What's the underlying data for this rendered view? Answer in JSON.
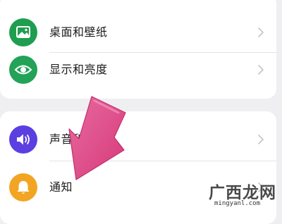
{
  "colors": {
    "wallpaper_icon": "#1f9e4f",
    "display_icon": "#23a258",
    "sound_icon": "#5b3fe0",
    "notification_icon": "#f2a522",
    "arrow": "#e04a86",
    "chevron": "#c4c4c8"
  },
  "settings": {
    "group1": [
      {
        "label": "桌面和壁纸",
        "icon": "picture-icon"
      },
      {
        "label": "显示和亮度",
        "icon": "eye-icon"
      }
    ],
    "group2": [
      {
        "label": "声音和振动",
        "icon": "speaker-icon"
      },
      {
        "label": "通知",
        "icon": "bell-icon"
      }
    ]
  },
  "watermark": {
    "text": "广西龙网",
    "url": "mingyanl.com"
  }
}
